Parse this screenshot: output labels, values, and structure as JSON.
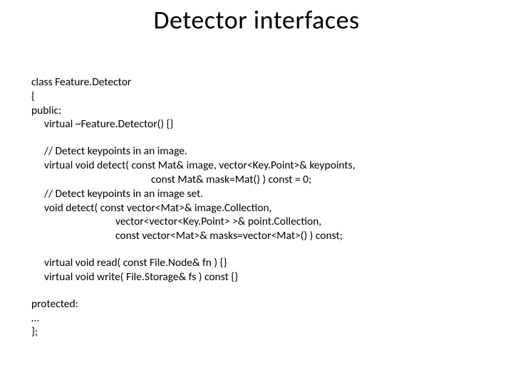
{
  "title": "Detector interfaces",
  "code": {
    "l1": "class Feature.Detector",
    "l2": "{",
    "l3": "public:",
    "l4": "virtual ~Feature.Detector() {}",
    "l5": "// Detect keypoints in an image.",
    "l6": "virtual void detect( const Mat& image, vector<Key.Point>& keypoints,",
    "l7": "const Mat& mask=Mat() ) const = 0;",
    "l8": "// Detect keypoints in an image set.",
    "l9": "void detect( const vector<Mat>& image.Collection,",
    "l10": "vector<vector<Key.Point> >& point.Collection,",
    "l11": "const vector<Mat>& masks=vector<Mat>() ) const;",
    "l12": "virtual void read( const File.Node& fn ) {}",
    "l13": "virtual void write( File.Storage& fs ) const {}",
    "l14": "protected:",
    "l15": "…",
    "l16": "};"
  }
}
